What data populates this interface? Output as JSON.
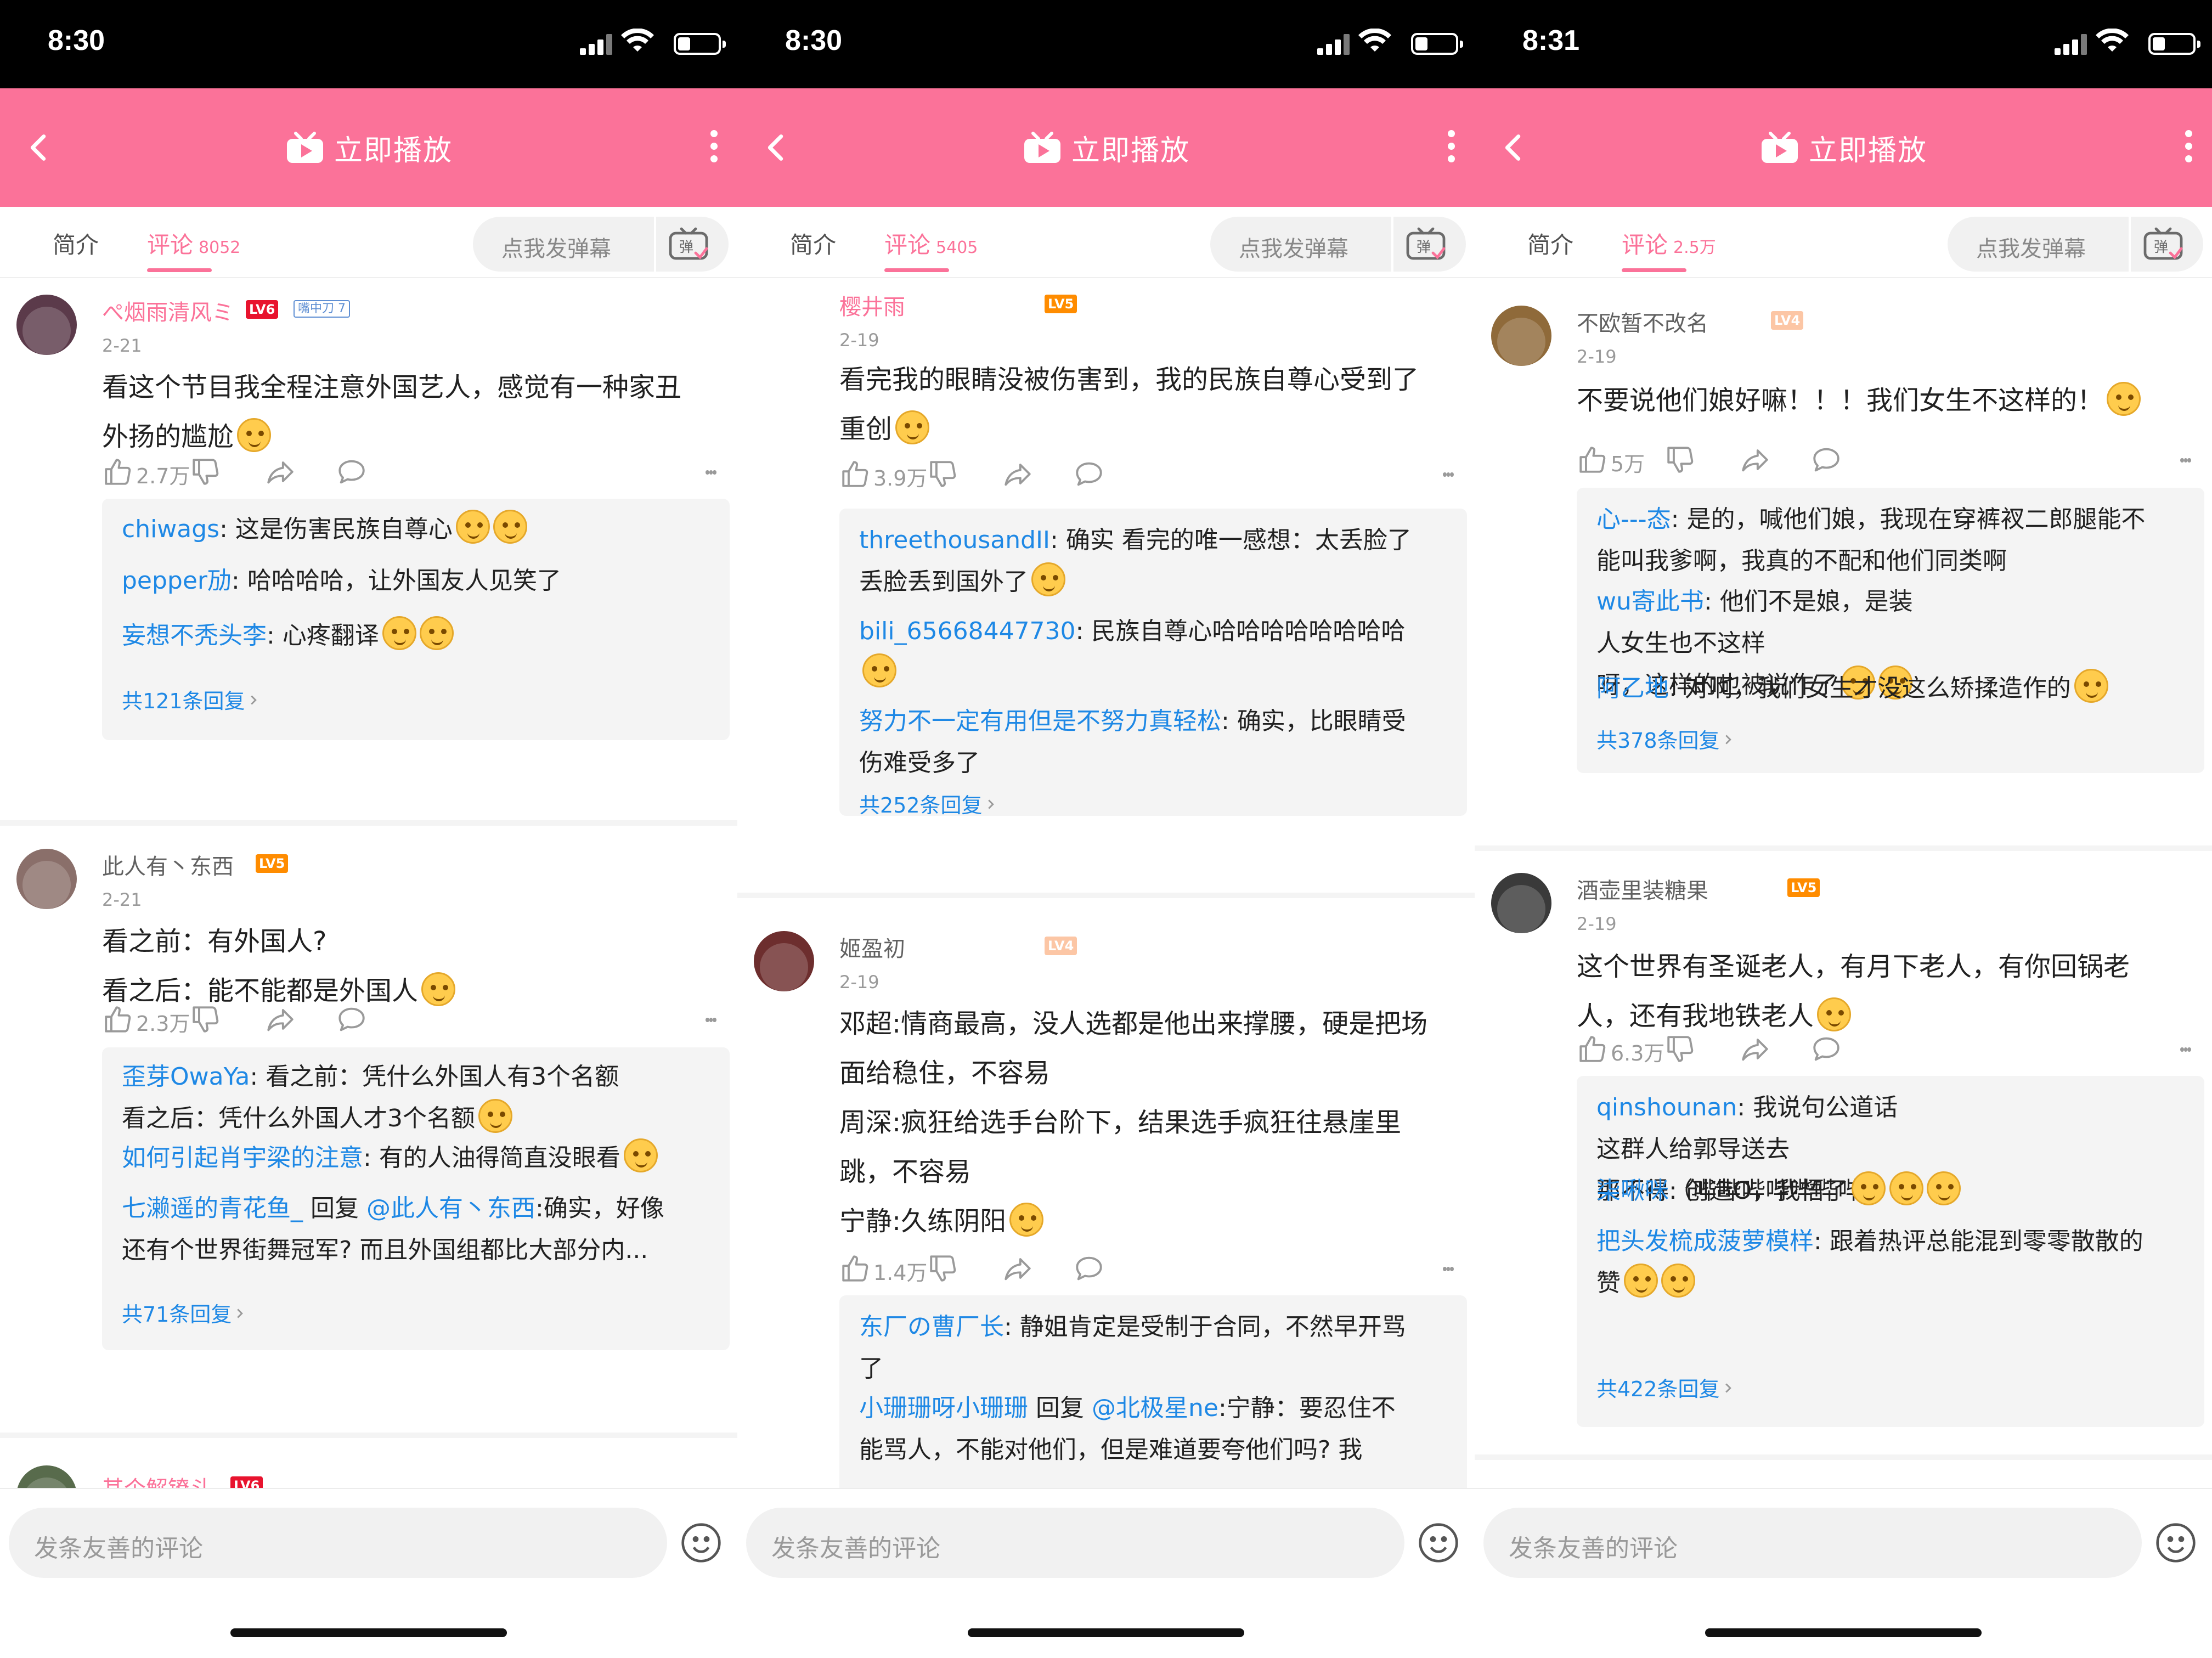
{
  "app": {
    "nav_title": "立即播放",
    "tab_intro": "简介",
    "tab_comments": "评论",
    "danmaku_placeholder": "点我发弹幕",
    "danmaku_icon_label": "弹",
    "comment_input_placeholder": "发条友善的评论",
    "accent_color": "#fb7299",
    "link_color": "#1e88e5"
  },
  "screens": [
    {
      "time": "8:30",
      "comment_count": "8052",
      "comments": [
        {
          "username": "ぺ烟雨清风ミ",
          "level": "LV6",
          "medal": "嘴中刀 7",
          "date": "2-21",
          "lines": [
            "看这个节目我全程注意外国艺人，感觉有一种家丑",
            "外扬的尴尬"
          ],
          "likes": "2.7万",
          "replies": [
            {
              "name": "chiwags",
              "lines": [
                "这是伤害民族自尊心"
              ],
              "emoji": 2
            },
            {
              "name": "pepper劢",
              "lines": [
                "哈哈哈哈，让外国友人见笑了"
              ],
              "emoji": 0
            },
            {
              "name": "妄想不秃头李",
              "lines": [
                "心疼翻译"
              ],
              "emoji": 2
            }
          ],
          "more_replies": "共121条回复"
        },
        {
          "username": "此人有丶东西",
          "level": "LV5",
          "date": "2-21",
          "lines": [
            "看之前：有外国人?",
            "看之后：能不能都是外国人"
          ],
          "likes": "2.3万",
          "replies": [
            {
              "name": "歪芽OwaYa",
              "lines": [
                "看之前：凭什么外国人有3个名额",
                "看之后：凭什么外国人才3个名额"
              ],
              "emoji": 1
            },
            {
              "name": "如何引起肖宇梁的注意",
              "lines": [
                "有的人油得简直没眼看"
              ],
              "emoji": 1
            },
            {
              "name": "七濑遥的青花鱼_",
              "reply_word": "回复",
              "at": "@此人有丶东西",
              "lines": [
                ":确实，好像",
                "还有个世界街舞冠军? 而且外国组都比大部分内..."
              ],
              "emoji": 0
            }
          ],
          "more_replies": "共71条回复"
        },
        {
          "username": "其个解镣斗",
          "level": "LV6"
        }
      ]
    },
    {
      "time": "8:30",
      "comment_count": "5405",
      "comments": [
        {
          "username": "樱井雨",
          "level": "LV5",
          "date": "2-19",
          "lines": [
            "看完我的眼睛没被伤害到，我的民族自尊心受到了",
            "重创"
          ],
          "likes": "3.9万",
          "replies": [
            {
              "name": "threethousandII",
              "lines": [
                "确实 看完的唯一感想：太丢脸了",
                "丢脸丢到国外了"
              ],
              "emoji": 1
            },
            {
              "name": "bili_65668447730",
              "lines": [
                "民族自尊心哈哈哈哈哈哈哈哈",
                ""
              ],
              "emoji": 1
            },
            {
              "name": "努力不一定有用但是不努力真轻松",
              "lines": [
                "确实，比眼睛受",
                "伤难受多了"
              ],
              "emoji": 0
            }
          ],
          "more_replies": "共252条回复"
        },
        {
          "username": "姬盈初",
          "level": "LV4",
          "date": "2-19",
          "lines": [
            "邓超:情商最高，没人选都是他出来撑腰，硬是把场",
            "面给稳住，不容易",
            "周深:疯狂给选手台阶下，结果选手疯狂往悬崖里",
            "跳，不容易",
            "宁静:久练阴阳"
          ],
          "likes": "1.4万",
          "replies": [
            {
              "name": "东厂の曹厂长",
              "lines": [
                "静姐肯定是受制于合同，不然早开骂",
                "了"
              ],
              "emoji": 0
            },
            {
              "name": "小珊珊呀小珊珊",
              "reply_word": "回复",
              "at": "@北极星ne",
              "lines": [
                ":宁静：要忍住不",
                "能骂人，不能对他们，但是难道要夸他们吗? 我"
              ],
              "emoji": 0
            }
          ]
        }
      ]
    },
    {
      "time": "8:31",
      "comment_count": "2.5万",
      "comments": [
        {
          "username": "不欧暂不改名",
          "level": "LV4",
          "date": "2-19",
          "lines": [
            "不要说他们娘好嘛！！！我们女生不这样的！"
          ],
          "likes": "5万",
          "replies": [
            {
              "name": "心---态",
              "lines": [
                "是的，喊他们娘，我现在穿裤衩二郎腿能不",
                "能叫我爹啊，我真的不配和他们同类啊"
              ],
              "emoji": 0
            },
            {
              "name": "wu寄此书",
              "lines": [
                "他们不是娘，是装",
                "人女生也不这样",
                "呀，这样的也被说作了"
              ],
              "emoji": 2
            },
            {
              "name": "阿乙地",
              "lines": [
                "对啊，我们女生才没这么矫揉造作的"
              ],
              "emoji": 1
            }
          ],
          "more_replies": "共378条回复"
        },
        {
          "username": "酒壶里装糖果",
          "level": "LV5",
          "date": "2-19",
          "lines": [
            "这个世界有圣诞老人，有月下老人，有你回锅老",
            "人，还有我地铁老人"
          ],
          "likes": "6.3万",
          "replies": [
            {
              "name": "qinshounan",
              "lines": [
                "我说句公道话",
                "这群人给郭导送去",
                "那不得（哔哔哔哔哔哔哔）"
              ],
              "emoji": 2
            },
            {
              "name": "柒啾咪",
              "lines": [
                "创造O，我悟了"
              ],
              "emoji": 1
            },
            {
              "name": "把头发梳成菠萝模样",
              "lines": [
                "跟着热评总能混到零零散散的",
                "赞"
              ],
              "emoji": 2
            }
          ],
          "more_replies": "共422条回复"
        }
      ]
    }
  ]
}
